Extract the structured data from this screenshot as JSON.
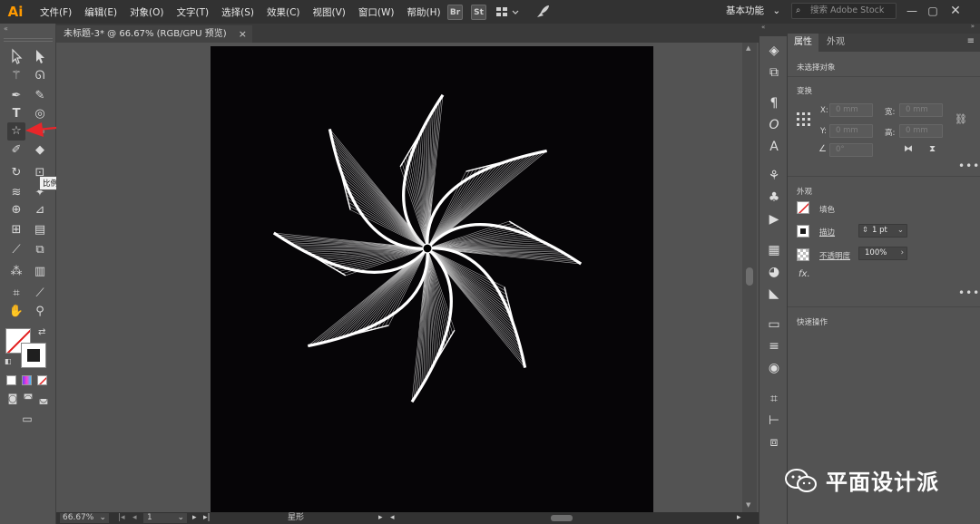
{
  "app": {
    "logo": "Ai",
    "accent": "#ff9a00"
  },
  "menu": [
    "文件(F)",
    "编辑(E)",
    "对象(O)",
    "文字(T)",
    "选择(S)",
    "效果(C)",
    "视图(V)",
    "窗口(W)",
    "帮助(H)"
  ],
  "header": {
    "bridge_label": "Br",
    "stock_label": "St",
    "workspace": "基本功能",
    "search_placeholder": "搜索 Adobe Stock"
  },
  "document": {
    "tab_title": "未标题-3* @ 66.67% (RGB/GPU 预览)",
    "close": "×"
  },
  "tooltip": "比例缩放工具 (S)",
  "status": {
    "zoom": "66.67%",
    "page": "1",
    "tool_name": "星形"
  },
  "panel": {
    "tab_properties": "属性",
    "tab_appearance": "外观",
    "no_selection": "未选择对象",
    "transform_label": "变换",
    "x_label": "X:",
    "y_label": "Y:",
    "w_label": "宽:",
    "h_label": "高:",
    "x_value": "0 mm",
    "y_value": "0 mm",
    "w_value": "0 mm",
    "h_value": "0 mm",
    "angle_value": "0°",
    "appearance_label": "外观",
    "fill_label": "填色",
    "stroke_label": "描边",
    "stroke_weight": "1 pt",
    "opacity_label": "不透明度",
    "opacity_value": "100%",
    "fx_label": "fx.",
    "quick_actions_label": "快速操作",
    "more": "•••"
  },
  "watermark": "平面设计派",
  "colors": {
    "canvas_bg": "#535353",
    "artboard": "#060507",
    "menubar": "#323232",
    "red_arrow": "#e8262a"
  },
  "icons": [
    "selection-icon",
    "direct-selection-icon",
    "magic-wand-icon",
    "lasso-icon",
    "pen-icon",
    "curvature-icon",
    "type-icon",
    "spiral-icon",
    "star-icon",
    "paintbrush-icon",
    "pencil-icon",
    "blob-brush-icon",
    "eraser-icon",
    "rotate-icon",
    "scale-icon",
    "width-icon",
    "warp-icon",
    "shape-builder-icon",
    "perspective-icon",
    "mesh-icon",
    "gradient-icon",
    "eyedropper-icon",
    "blend-icon",
    "symbol-sprayer-icon",
    "graph-icon",
    "artboard-icon",
    "slice-icon",
    "hand-icon",
    "zoom-icon"
  ]
}
